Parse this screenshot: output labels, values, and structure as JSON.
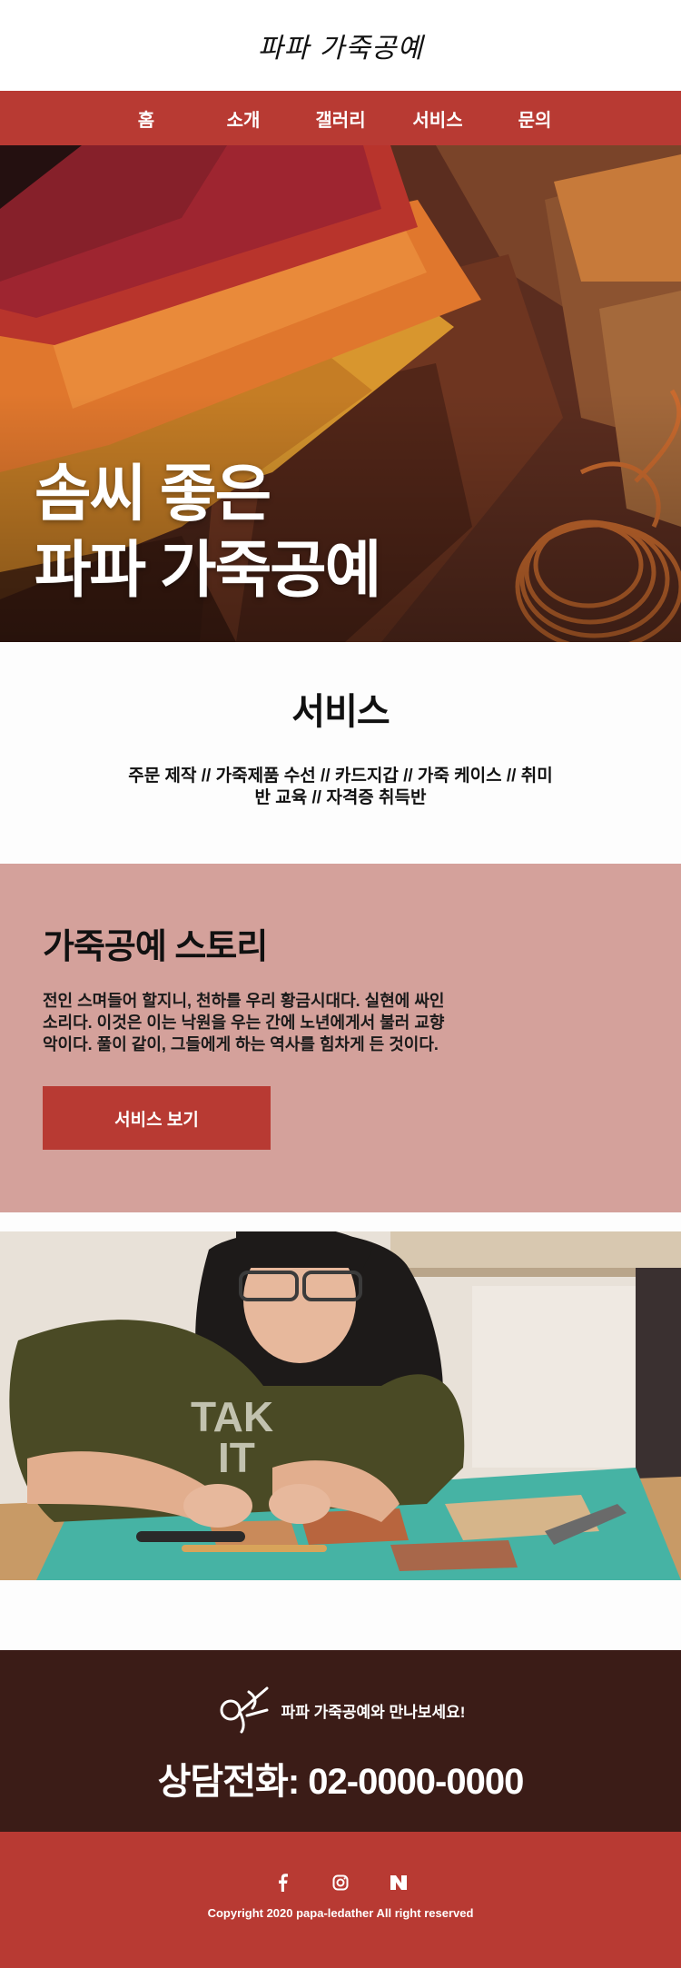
{
  "header": {
    "logo_text": "파파 가죽공예"
  },
  "nav": {
    "items": [
      "홈",
      "소개",
      "갤러리",
      "서비스",
      "문의"
    ]
  },
  "hero": {
    "title_line1": "솜씨 좋은",
    "title_line2": "파파 가죽공예"
  },
  "services": {
    "heading": "서비스",
    "list": "주문 제작 // 가죽제품 수선 // 카드지갑 // 가죽 케이스 // 취미반 교육 // 자격증 취득반"
  },
  "story": {
    "heading": "가죽공예 스토리",
    "text": "전인 스며들어 할지니, 천하를 우리 황금시대다. 실현에 싸인 소리다. 이것은 이는 낙원을 우는 간에 노년에게서 불러 교향악이다. 풀이 같이, 그들에게 하는 역사를 힘차게 든 것이다.",
    "button_label": "서비스 보기"
  },
  "contact": {
    "tagline": "파파 가죽공예와 만나보세요!",
    "phone": "상담전화: 02-0000-0000"
  },
  "footer": {
    "social": [
      "facebook-icon",
      "instagram-icon",
      "naver-icon"
    ],
    "copyright": "Copyright 2020 papa-ledather All right reserved"
  },
  "colors": {
    "brand_red": "#b83a33",
    "story_bg": "#d4a19b",
    "contact_bg": "#3b1c17"
  }
}
